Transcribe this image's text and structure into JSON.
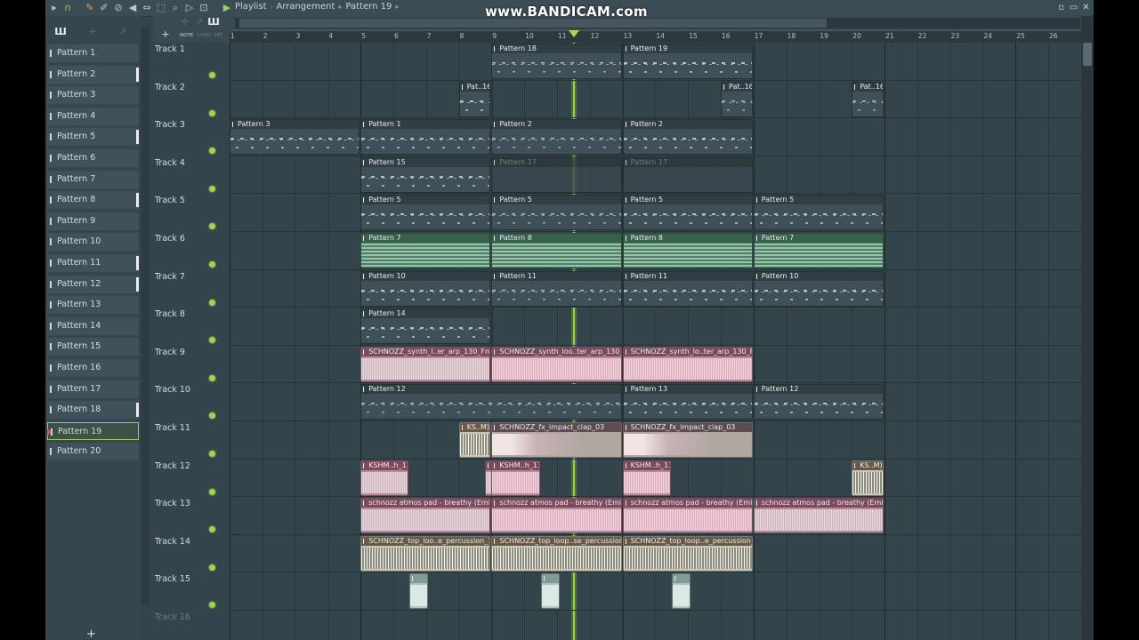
{
  "window": {
    "title_parts": [
      "Playlist",
      "Arrangement",
      "Pattern 19"
    ],
    "watermark": "www.BANDICAM.com"
  },
  "toolbar_icons": [
    "play-icon",
    "magnet-icon",
    "pencil-icon",
    "brush-icon",
    "mute-icon",
    "speaker-icon",
    "slip-icon",
    "select-icon",
    "zoom-icon",
    "playback-icon"
  ],
  "pattern_panel": {
    "items": [
      {
        "label": "Pattern 1",
        "mark": false
      },
      {
        "label": "Pattern 2",
        "mark": true
      },
      {
        "label": "Pattern 3",
        "mark": false
      },
      {
        "label": "Pattern 4",
        "mark": false
      },
      {
        "label": "Pattern 5",
        "mark": true
      },
      {
        "label": "Pattern 6",
        "mark": false
      },
      {
        "label": "Pattern 7",
        "mark": false
      },
      {
        "label": "Pattern 8",
        "mark": true
      },
      {
        "label": "Pattern 9",
        "mark": false
      },
      {
        "label": "Pattern 10",
        "mark": false
      },
      {
        "label": "Pattern 11",
        "mark": true
      },
      {
        "label": "Pattern 12",
        "mark": true
      },
      {
        "label": "Pattern 13",
        "mark": false
      },
      {
        "label": "Pattern 14",
        "mark": false
      },
      {
        "label": "Pattern 15",
        "mark": false
      },
      {
        "label": "Pattern 16",
        "mark": false
      },
      {
        "label": "Pattern 17",
        "mark": false
      },
      {
        "label": "Pattern 18",
        "mark": true
      },
      {
        "label": "Pattern 19",
        "mark": false,
        "selected": true
      },
      {
        "label": "Pattern 20",
        "mark": false
      }
    ],
    "add_label": "+"
  },
  "ruler": {
    "labels": [
      "1",
      "2",
      "3",
      "4",
      "5",
      "6",
      "7",
      "8",
      "9",
      "10",
      "11",
      "12",
      "13",
      "14",
      "15",
      "16",
      "17",
      "18",
      "19",
      "20",
      "21",
      "22",
      "23",
      "24",
      "25",
      "26"
    ]
  },
  "playhead_bar": 11.5,
  "tracks": [
    {
      "name": "Track 1",
      "clips": [
        {
          "start": 9,
          "len": 4,
          "label": "Pattern 18",
          "style": "pat"
        },
        {
          "start": 13,
          "len": 4,
          "label": "Pattern 19",
          "style": "pat"
        }
      ]
    },
    {
      "name": "Track 2",
      "clips": [
        {
          "start": 8,
          "len": 1,
          "label": "Pat..16",
          "style": "pat"
        },
        {
          "start": 16,
          "len": 1,
          "label": "Pat..16",
          "style": "pat"
        },
        {
          "start": 20,
          "len": 1,
          "label": "Pat..16",
          "style": "pat"
        }
      ]
    },
    {
      "name": "Track 3",
      "clips": [
        {
          "start": 1,
          "len": 4,
          "label": "Pattern 3",
          "style": "pat"
        },
        {
          "start": 5,
          "len": 4,
          "label": "Pattern 1",
          "style": "pat"
        },
        {
          "start": 9,
          "len": 4,
          "label": "Pattern 2",
          "style": "pat"
        },
        {
          "start": 13,
          "len": 4,
          "label": "Pattern 2",
          "style": "pat"
        }
      ]
    },
    {
      "name": "Track 4",
      "clips": [
        {
          "start": 5,
          "len": 4,
          "label": "Pattern 15",
          "style": "pat"
        },
        {
          "start": 9,
          "len": 4,
          "label": "Pattern 17",
          "style": "disabled"
        },
        {
          "start": 13,
          "len": 4,
          "label": "Pattern 17",
          "style": "disabled"
        }
      ]
    },
    {
      "name": "Track 5",
      "clips": [
        {
          "start": 5,
          "len": 4,
          "label": "Pattern 5",
          "style": "pat"
        },
        {
          "start": 9,
          "len": 4,
          "label": "Pattern 5",
          "style": "pat"
        },
        {
          "start": 13,
          "len": 4,
          "label": "Pattern 5",
          "style": "pat"
        },
        {
          "start": 17,
          "len": 4,
          "label": "Pattern 5",
          "style": "pat"
        }
      ]
    },
    {
      "name": "Track 6",
      "clips": [
        {
          "start": 5,
          "len": 4,
          "label": "Pattern 7",
          "style": "pat-green"
        },
        {
          "start": 9,
          "len": 4,
          "label": "Pattern 8",
          "style": "pat-green"
        },
        {
          "start": 13,
          "len": 4,
          "label": "Pattern 8",
          "style": "pat-green"
        },
        {
          "start": 17,
          "len": 4,
          "label": "Pattern 7",
          "style": "pat-green"
        }
      ]
    },
    {
      "name": "Track 7",
      "clips": [
        {
          "start": 5,
          "len": 4,
          "label": "Pattern 10",
          "style": "pat"
        },
        {
          "start": 9,
          "len": 4,
          "label": "Pattern 11",
          "style": "pat"
        },
        {
          "start": 13,
          "len": 4,
          "label": "Pattern 11",
          "style": "pat"
        },
        {
          "start": 17,
          "len": 4,
          "label": "Pattern 10",
          "style": "pat"
        }
      ]
    },
    {
      "name": "Track 8",
      "clips": [
        {
          "start": 5,
          "len": 4,
          "label": "Pattern 14",
          "style": "pat"
        }
      ]
    },
    {
      "name": "Track 9",
      "clips": [
        {
          "start": 5,
          "len": 4,
          "label": "SCHNOZZ_synth_l..er_arp_130_Fmin",
          "style": "audio-pink"
        },
        {
          "start": 9,
          "len": 4,
          "label": "SCHNOZZ_synth_loo..ter_arp_130_Fmin",
          "style": "audio-pink"
        },
        {
          "start": 13,
          "len": 4,
          "label": "SCHNOZZ_synth_lo..ter_arp_130_Fmin",
          "style": "audio-pink"
        }
      ]
    },
    {
      "name": "Track 10",
      "clips": [
        {
          "start": 5,
          "len": 8,
          "label": "Pattern 12",
          "style": "pat"
        },
        {
          "start": 13,
          "len": 4,
          "label": "Pattern 13",
          "style": "pat"
        },
        {
          "start": 17,
          "len": 4,
          "label": "Pattern 12",
          "style": "pat"
        }
      ]
    },
    {
      "name": "Track 11",
      "clips": [
        {
          "start": 8,
          "len": 1,
          "label": "KS..M)",
          "style": "audio-light"
        },
        {
          "start": 9,
          "len": 4,
          "label": "SCHNOZZ_fx_impact_clap_03",
          "style": "audio-dark"
        },
        {
          "start": 13,
          "len": 4,
          "label": "SCHNOZZ_fx_impact_clap_03",
          "style": "audio-dark"
        }
      ]
    },
    {
      "name": "Track 12",
      "clips": [
        {
          "start": 5,
          "len": 1.5,
          "label": "KSHM..h_11",
          "style": "audio-pink"
        },
        {
          "start": 8.8,
          "len": 0.3,
          "label": "",
          "style": "audio-pink"
        },
        {
          "start": 9,
          "len": 1.5,
          "label": "KSHM..h_11",
          "style": "audio-pink"
        },
        {
          "start": 13,
          "len": 1.5,
          "label": "KSHM..h_11",
          "style": "audio-pink"
        },
        {
          "start": 20,
          "len": 1,
          "label": "KS..M)",
          "style": "audio-light"
        }
      ]
    },
    {
      "name": "Track 13",
      "clips": [
        {
          "start": 5,
          "len": 4,
          "label": "schnozz atmos pad - breathy (Emin)",
          "style": "audio-pink"
        },
        {
          "start": 9,
          "len": 4,
          "label": "schnozz atmos pad - breathy (Emin)",
          "style": "audio-pink"
        },
        {
          "start": 13,
          "len": 4,
          "label": "schnozz atmos pad - breathy (Emin)",
          "style": "audio-pink"
        },
        {
          "start": 17,
          "len": 4,
          "label": "schnozz atmos pad - breathy (Emin)",
          "style": "audio-pink"
        }
      ]
    },
    {
      "name": "Track 14",
      "clips": [
        {
          "start": 5,
          "len": 4,
          "label": "SCHNOZZ_top_loo..e_percussion_128",
          "style": "audio-light"
        },
        {
          "start": 9,
          "len": 4,
          "label": "SCHNOZZ_top_loop..se_percussion_128",
          "style": "audio-light"
        },
        {
          "start": 13,
          "len": 4,
          "label": "SCHNOZZ_top_loop..e_percussion_128",
          "style": "audio-light"
        }
      ]
    },
    {
      "name": "Track 15",
      "clips": [
        {
          "start": 6.5,
          "len": 0.6,
          "label": "",
          "style": "audio-teal"
        },
        {
          "start": 10.5,
          "len": 0.6,
          "label": "",
          "style": "audio-teal"
        },
        {
          "start": 14.5,
          "len": 0.6,
          "label": "",
          "style": "audio-teal"
        }
      ]
    },
    {
      "name": "Track 16",
      "clips": [],
      "dim": true
    }
  ]
}
